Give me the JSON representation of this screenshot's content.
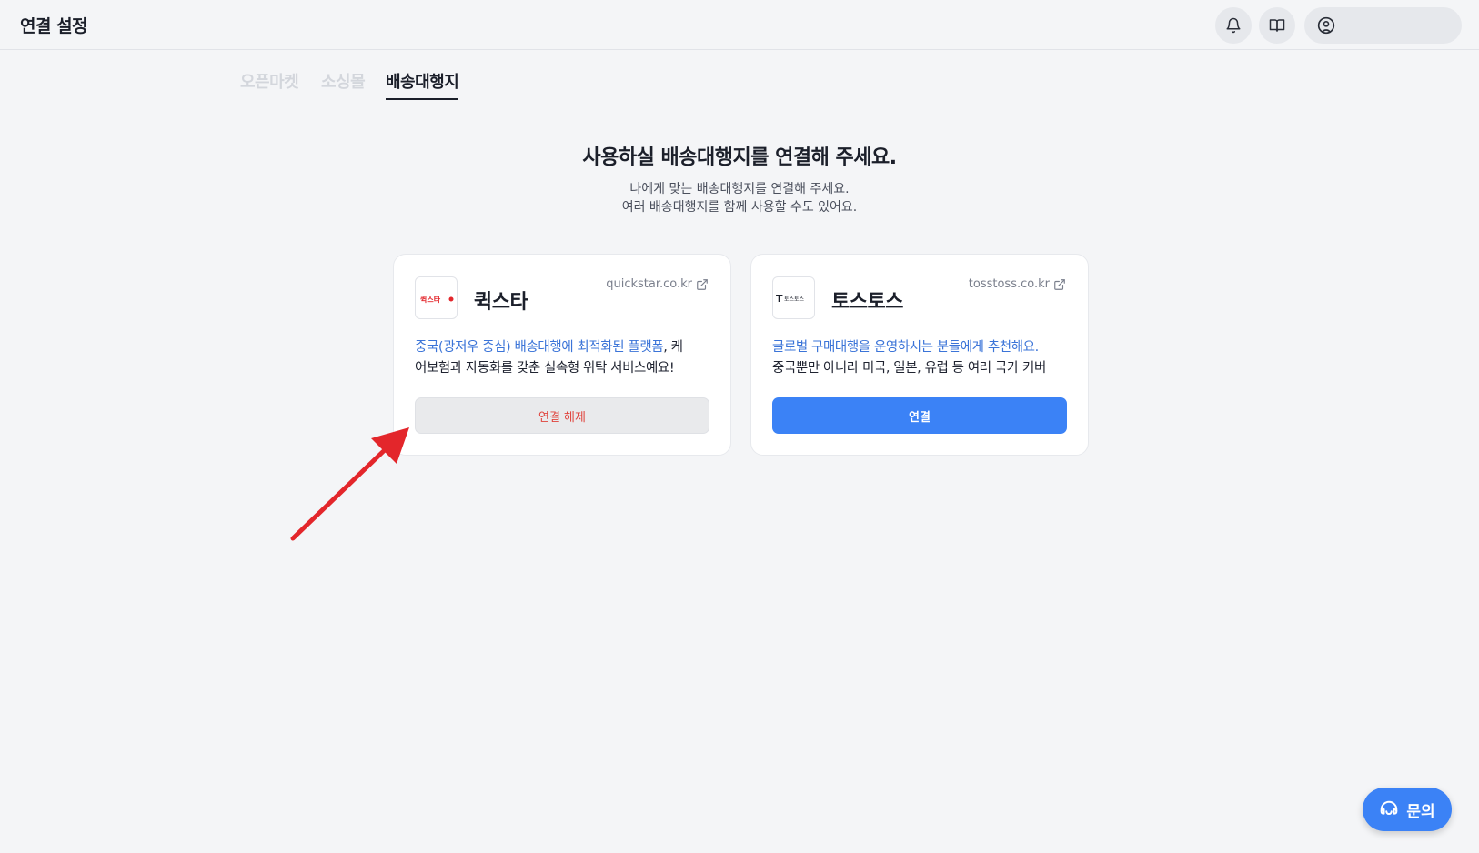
{
  "header": {
    "title": "연결 설정",
    "icons": [
      "bell-icon",
      "book-icon",
      "user-circle-icon"
    ]
  },
  "tabs": [
    {
      "label": "오픈마켓",
      "active": false
    },
    {
      "label": "소싱몰",
      "active": false
    },
    {
      "label": "배송대행지",
      "active": true
    }
  ],
  "hero": {
    "title": "사용하실 배송대행지를 연결해 주세요.",
    "subtitle_line1": "나에게 맞는 배송대행지를 연결해 주세요.",
    "subtitle_line2": "여러 배송대행지를 함께 사용할 수도 있어요."
  },
  "cards": [
    {
      "name": "퀵스타",
      "logo_text": "퀵스타",
      "site": "quickstar.co.kr",
      "desc_highlight": "중국(광저우 중심) 배송대행에 최적화된 플랫폼",
      "desc_rest_line1": ", 케",
      "desc_line2": "어보험과 자동화를 갖춘 실속형 위탁 서비스예요!",
      "button_label": "연결 해제",
      "connected": true
    },
    {
      "name": "토스토스",
      "logo_text": "토스토스",
      "site": "tosstoss.co.kr",
      "desc_highlight": "글로벌 구매대행을 운영하시는 분들에게 추천해요.",
      "desc_rest_line1": "",
      "desc_line2": "중국뿐만 아니라 미국, 일본, 유럽 등 여러 국가 커버",
      "button_label": "연결",
      "connected": false
    }
  ],
  "help_button": {
    "label": "문의"
  },
  "colors": {
    "accent": "#3b82f6",
    "link_blue": "#3b74d8",
    "danger": "#e0443d",
    "annotation_arrow": "#e3262b"
  }
}
